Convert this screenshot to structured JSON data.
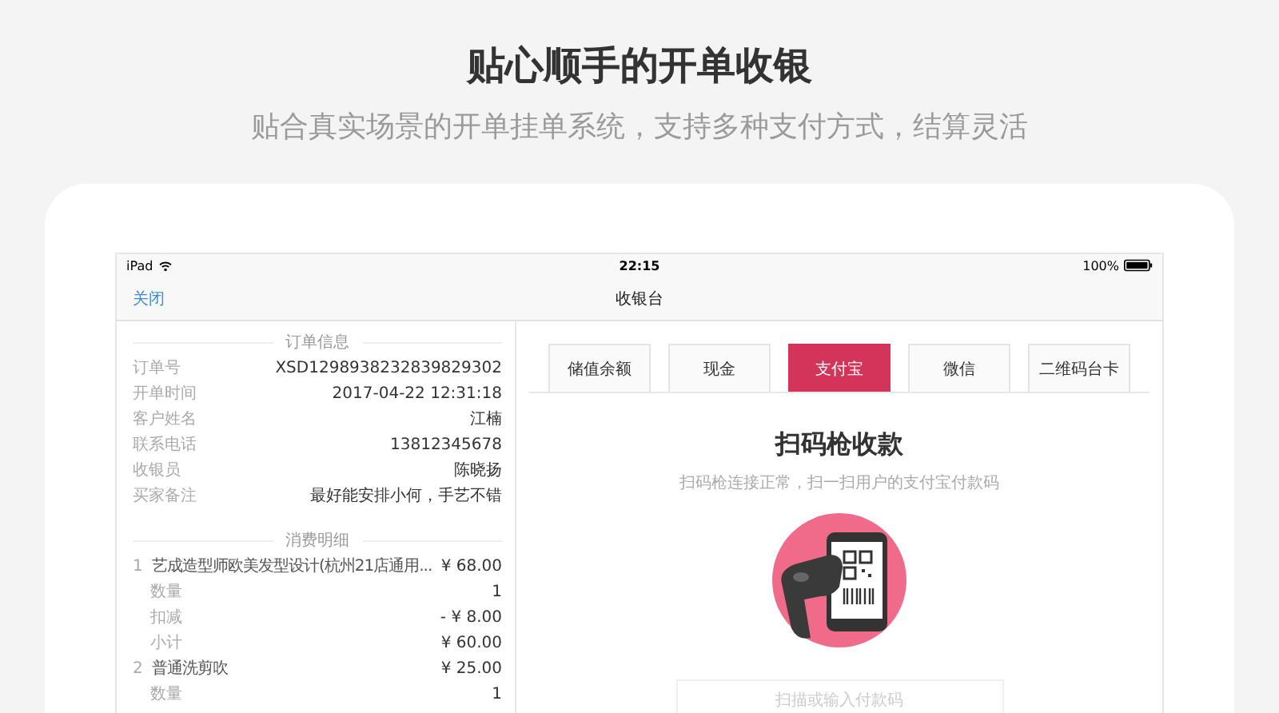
{
  "header": {
    "title": "贴心顺手的开单收银",
    "subtitle": "贴合真实场景的开单挂单系统，支持多种支付方式，结算灵活"
  },
  "status_bar": {
    "device": "iPad",
    "time": "22:15",
    "battery": "100%"
  },
  "nav": {
    "close": "关闭",
    "title": "收银台"
  },
  "order_info": {
    "title": "订单信息",
    "rows": [
      {
        "label": "订单号",
        "value": "XSD1298938232839829302"
      },
      {
        "label": "开单时间",
        "value": "2017-04-22  12:31:18"
      },
      {
        "label": "客户姓名",
        "value": "江楠"
      },
      {
        "label": "联系电话",
        "value": "13812345678"
      },
      {
        "label": "收银员",
        "value": "陈晓扬"
      },
      {
        "label": "买家备注",
        "value": "最好能安排小何，手艺不错"
      }
    ]
  },
  "consumption": {
    "title": "消费明细",
    "items": [
      {
        "index": "1",
        "name": "艺成造型师欧美发型设计(杭州21店通用...",
        "price": "¥ 68.00",
        "details": [
          {
            "label": "数量",
            "value": "1"
          },
          {
            "label": "扣减",
            "value": "- ¥ 8.00"
          },
          {
            "label": "小计",
            "value": "¥ 60.00"
          }
        ]
      },
      {
        "index": "2",
        "name": "普通洗剪吹",
        "price": "¥ 25.00",
        "details": [
          {
            "label": "数量",
            "value": "1"
          }
        ]
      }
    ]
  },
  "payment_tabs": [
    {
      "label": "储值余额",
      "selected": false
    },
    {
      "label": "现金",
      "selected": false
    },
    {
      "label": "支付宝",
      "selected": true
    },
    {
      "label": "微信",
      "selected": false
    },
    {
      "label": "二维码台卡",
      "selected": false
    }
  ],
  "scan": {
    "title": "扫码枪收款",
    "hint": "扫码枪连接正常，扫一扫用户的支付宝付款码",
    "input_placeholder": "扫描或输入付款码"
  }
}
